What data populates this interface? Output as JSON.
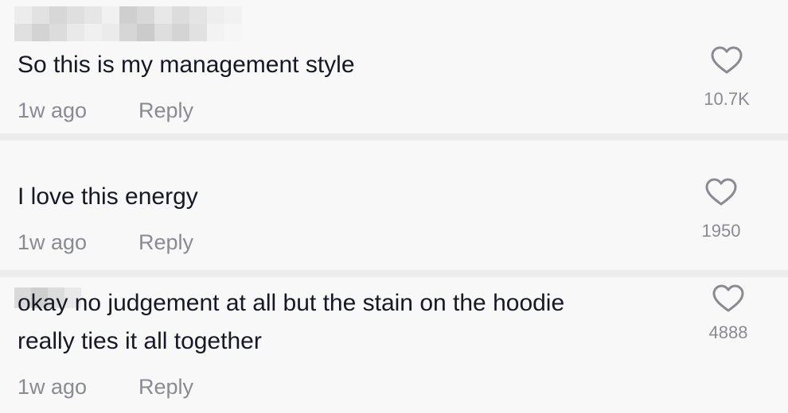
{
  "comments": [
    {
      "text": "So this is my management style",
      "time": "1w ago",
      "reply_label": "Reply",
      "likes": "10.7K"
    },
    {
      "text": "I love this energy",
      "time": "1w ago",
      "reply_label": "Reply",
      "likes": "1950"
    },
    {
      "text_line1": "okay no judgement at all but the stain on the hoodie",
      "text_line2": "really ties it all together",
      "time": "1w ago",
      "reply_label": "Reply",
      "likes": "4888"
    }
  ],
  "icons": {
    "like": "heart-outline-icon"
  },
  "colors": {
    "background": "#f8f8f8",
    "divider": "#ececec",
    "text": "#161823",
    "secondary_text": "#8a8b91"
  }
}
